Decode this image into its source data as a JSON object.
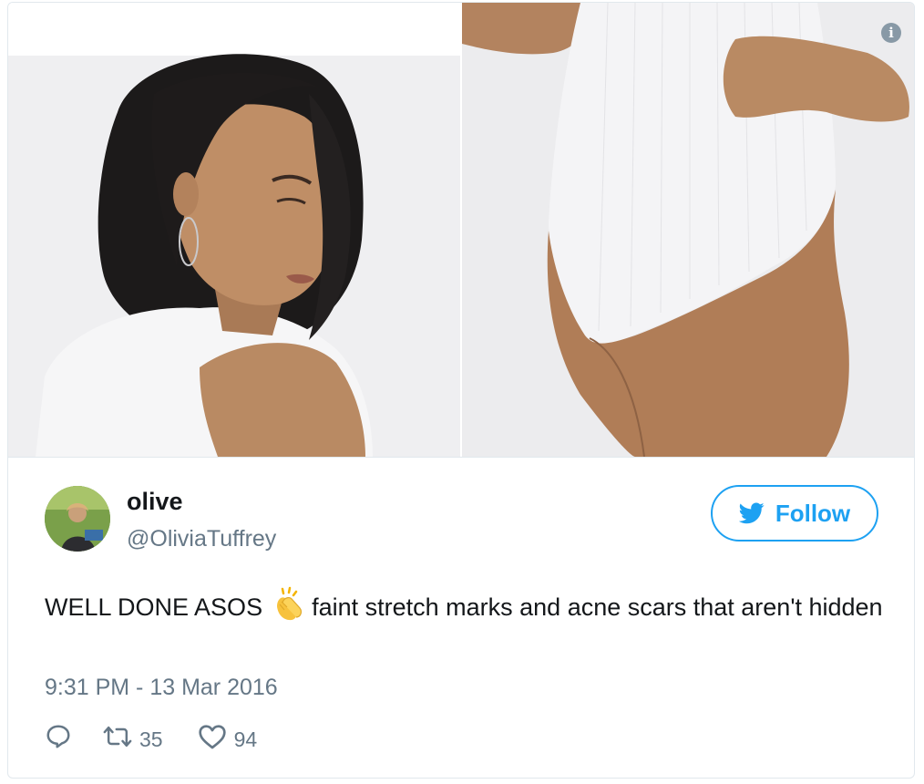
{
  "tweet": {
    "author": {
      "name": "olive",
      "handle": "@OliviaTuffrey"
    },
    "follow_label": "Follow",
    "text_before_emoji": "WELL DONE ASOS",
    "text_after_emoji": "faint stretch marks and acne scars that aren't hidden",
    "timestamp": "9:31 PM - 13 Mar 2016",
    "retweet_count": "35",
    "like_count": "94"
  },
  "icons": {
    "info": "info-icon",
    "follow": "twitter-bird-icon",
    "emoji": "clapping-hands-emoji",
    "reply": "reply-icon",
    "retweet": "retweet-icon",
    "like": "heart-icon"
  },
  "colors": {
    "twitter_blue": "#1da1f2",
    "secondary_text": "#657786",
    "primary_text": "#14171a",
    "border": "#e1e8ed"
  }
}
